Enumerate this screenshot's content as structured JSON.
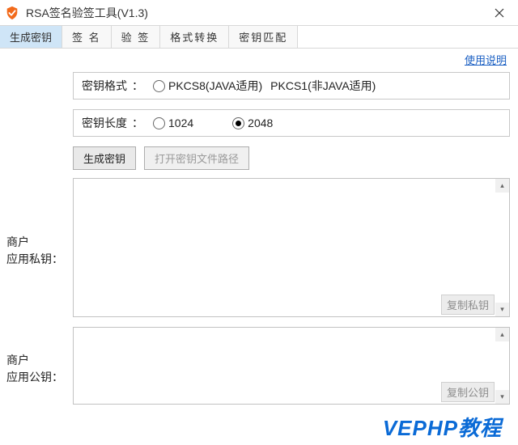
{
  "window": {
    "title": "RSA签名验签工具(V1.3)"
  },
  "tabs": [
    {
      "label": "生成密钥",
      "key": "gen",
      "active": true
    },
    {
      "label": "签  名",
      "key": "sign"
    },
    {
      "label": "验  签",
      "key": "verify"
    },
    {
      "label": "格式转换",
      "key": "convert"
    },
    {
      "label": "密钥匹配",
      "key": "match"
    }
  ],
  "help_link": "使用说明",
  "key_format": {
    "label": "密钥格式",
    "colon": "：",
    "options": [
      {
        "label": "PKCS8(JAVA适用)",
        "value": "pkcs8",
        "checked": false
      },
      {
        "label": "PKCS1(非JAVA适用)",
        "value": "pkcs1",
        "checked": false
      }
    ]
  },
  "key_length": {
    "label": "密钥长度",
    "colon": "：",
    "options": [
      {
        "label": "1024",
        "value": "1024",
        "checked": false
      },
      {
        "label": "2048",
        "value": "2048",
        "checked": true
      }
    ]
  },
  "buttons": {
    "generate": "生成密钥",
    "open_path": "打开密钥文件路径"
  },
  "private_key": {
    "label_line1": "商户",
    "label_line2": "应用私钥：",
    "copy": "复制私钥",
    "value": ""
  },
  "public_key": {
    "label_line1": "商户",
    "label_line2": "应用公钥：",
    "copy": "复制公钥",
    "value": ""
  },
  "watermark": "VEPHP教程"
}
